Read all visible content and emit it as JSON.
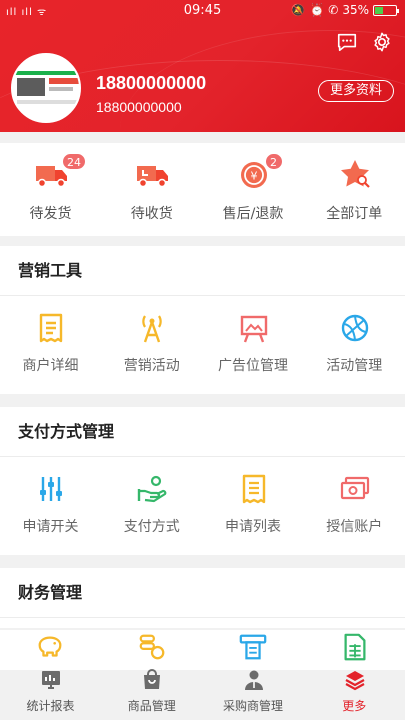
{
  "status_bar": {
    "left": "ıll ıll ᯤ",
    "time": "09:45",
    "right_icons": "🔕 ⏰ ✆",
    "battery": "35%"
  },
  "header": {
    "username": "18800000000",
    "phone": "18800000000",
    "more_label": "更多资料",
    "colors": {
      "primary": "#e3232b"
    }
  },
  "orders": [
    {
      "label": "待发货",
      "badge": "24",
      "icon": "truck-icon"
    },
    {
      "label": "待收货",
      "badge": "",
      "icon": "delivery-truck-icon"
    },
    {
      "label": "售后/退款",
      "badge": "2",
      "icon": "refund-icon"
    },
    {
      "label": "全部订单",
      "badge": "",
      "icon": "star-search-icon"
    }
  ],
  "marketing": {
    "title": "营销工具",
    "items": [
      {
        "label": "商户详细",
        "icon": "document-icon"
      },
      {
        "label": "营销活动",
        "icon": "signal-tower-icon"
      },
      {
        "label": "广告位管理",
        "icon": "billboard-icon"
      },
      {
        "label": "活动管理",
        "icon": "basketball-icon"
      }
    ]
  },
  "payment": {
    "title": "支付方式管理",
    "items": [
      {
        "label": "申请开关",
        "icon": "sliders-icon"
      },
      {
        "label": "支付方式",
        "icon": "hand-coin-icon"
      },
      {
        "label": "申请列表",
        "icon": "receipt-icon"
      },
      {
        "label": "授信账户",
        "icon": "cash-icon"
      }
    ]
  },
  "finance": {
    "title": "财务管理",
    "items": [
      {
        "icon": "piggy-bank-icon"
      },
      {
        "icon": "coins-icon"
      },
      {
        "icon": "atm-icon"
      },
      {
        "icon": "spreadsheet-icon"
      }
    ]
  },
  "bottom_nav": [
    {
      "label": "统计报表",
      "icon": "report-icon"
    },
    {
      "label": "商品管理",
      "icon": "bag-icon"
    },
    {
      "label": "采购商管理",
      "icon": "person-icon"
    },
    {
      "label": "更多",
      "icon": "layers-icon",
      "active": true
    }
  ]
}
